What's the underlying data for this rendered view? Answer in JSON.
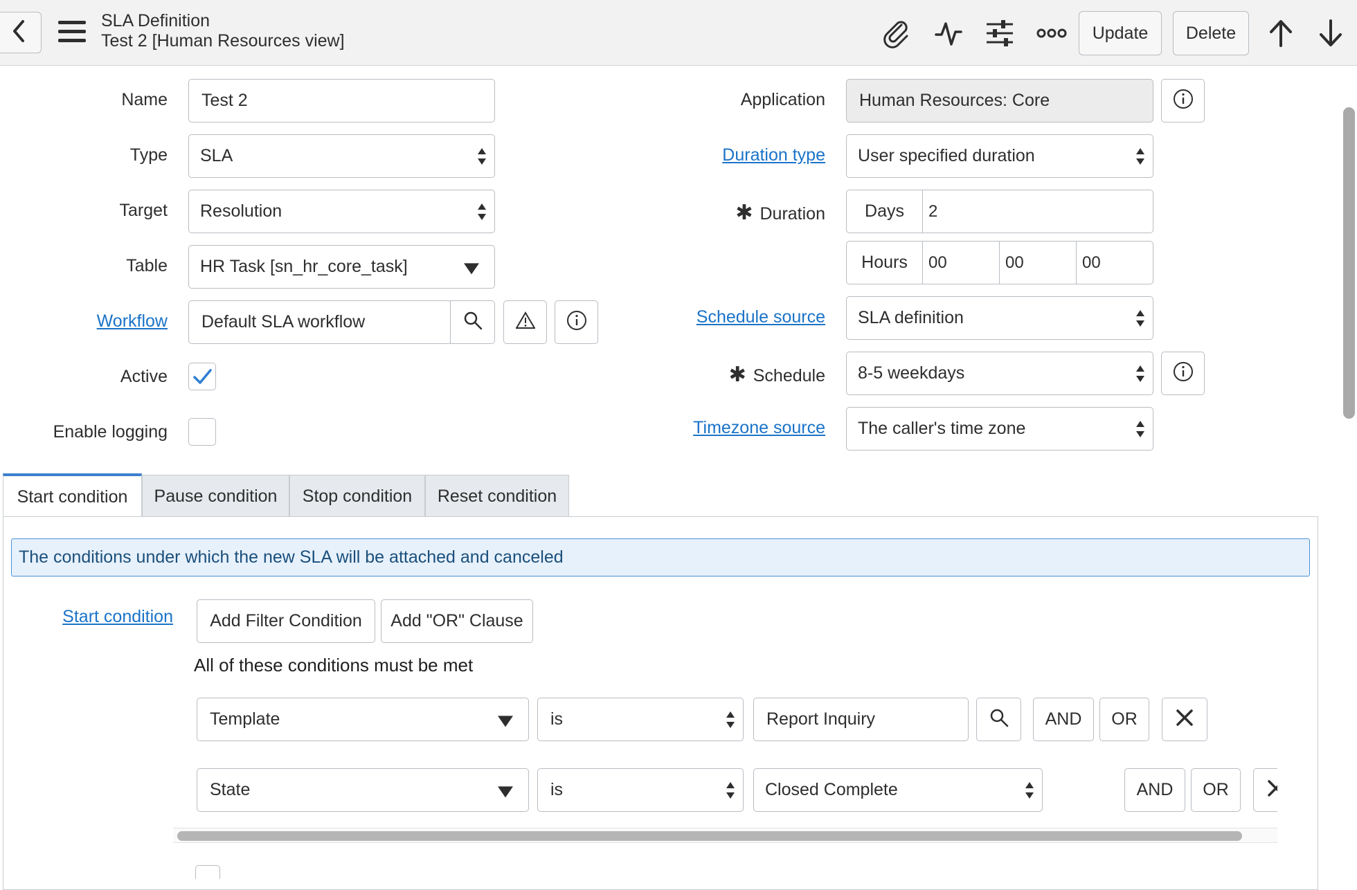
{
  "header": {
    "title": "SLA Definition",
    "subtitle": "Test 2 [Human Resources view]",
    "update_label": "Update",
    "delete_label": "Delete",
    "icons": [
      "back-icon",
      "menu-icon",
      "attachment-icon",
      "activity-icon",
      "settings-icon",
      "more-icon",
      "arrow-up-icon",
      "arrow-down-icon"
    ]
  },
  "form": {
    "name": {
      "label": "Name",
      "value": "Test 2"
    },
    "type": {
      "label": "Type",
      "value": "SLA"
    },
    "target": {
      "label": "Target",
      "value": "Resolution"
    },
    "table": {
      "label": "Table",
      "value": "HR Task [sn_hr_core_task]"
    },
    "workflow": {
      "label": "Workflow",
      "value": "Default SLA workflow"
    },
    "active": {
      "label": "Active",
      "checked": true
    },
    "enable_logging": {
      "label": "Enable logging",
      "checked": false
    },
    "application": {
      "label": "Application",
      "value": "Human Resources: Core"
    },
    "duration_type": {
      "label": "Duration type",
      "value": "User specified duration"
    },
    "duration": {
      "label": "Duration",
      "days_label": "Days",
      "days_value": "2",
      "hours_label": "Hours",
      "hours": "00",
      "minutes": "00",
      "seconds": "00"
    },
    "schedule_source": {
      "label": "Schedule source",
      "value": "SLA definition"
    },
    "schedule": {
      "label": "Schedule",
      "value": "8-5 weekdays"
    },
    "timezone_source": {
      "label": "Timezone source",
      "value": "The caller's time zone"
    },
    "required_mark": "✱"
  },
  "tabs": [
    {
      "label": "Start condition",
      "active": true
    },
    {
      "label": "Pause condition",
      "active": false
    },
    {
      "label": "Stop condition",
      "active": false
    },
    {
      "label": "Reset condition",
      "active": false
    }
  ],
  "condition": {
    "banner": "The conditions under which the new SLA will be attached and canceled",
    "label": "Start condition",
    "add_filter_label": "Add Filter Condition",
    "add_or_label": "Add \"OR\" Clause",
    "must_be_met": "All of these conditions must be met",
    "rows": [
      {
        "field": "Template",
        "operator": "is",
        "value": "Report Inquiry",
        "and": "AND",
        "or": "OR"
      },
      {
        "field": "State",
        "operator": "is",
        "value": "Closed Complete",
        "and": "AND",
        "or": "OR"
      }
    ]
  },
  "colors": {
    "accent": "#3d7fce",
    "link": "#1a73c8",
    "banner_bg": "#e7f1fb"
  }
}
